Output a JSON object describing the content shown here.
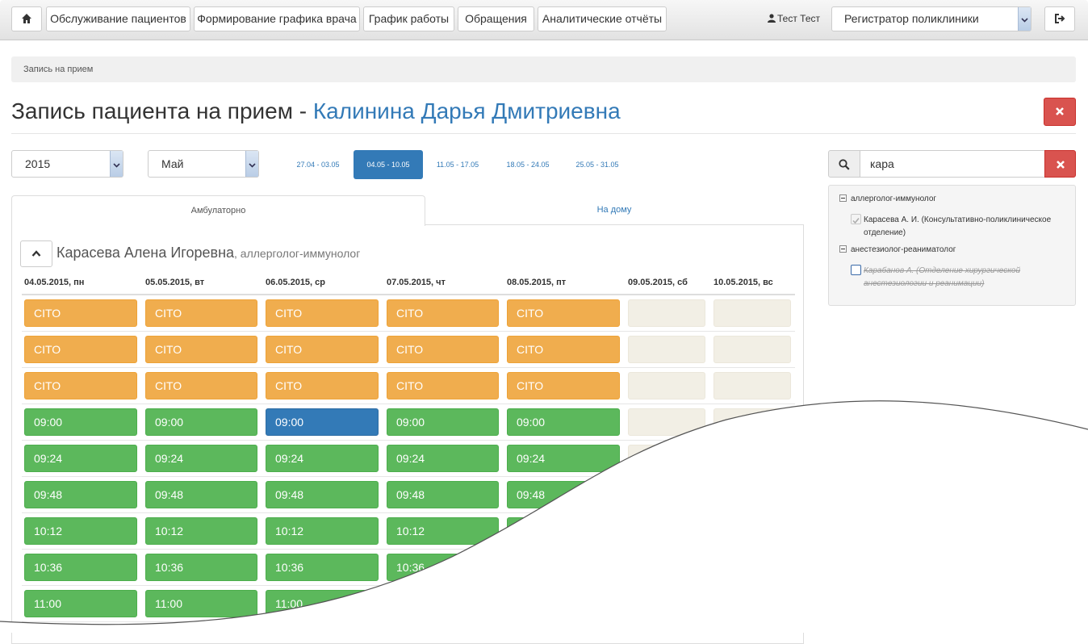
{
  "nav": {
    "items": [
      {
        "label": "Обслуживание пациентов"
      },
      {
        "label": "Формирование графика врача"
      },
      {
        "label": "График работы"
      },
      {
        "label": "Обращения"
      },
      {
        "label": "Аналитические отчёты"
      }
    ],
    "user_name": "Тест Тест",
    "role": "Регистратор поликлиники"
  },
  "breadcrumb": "Запись на прием",
  "page": {
    "title": "Запись пациента на прием -",
    "patient": "Калинина Дарья Дмитриевна"
  },
  "filters": {
    "year": "2015",
    "month": "Май",
    "weeks": [
      "27.04 - 03.05",
      "04.05 - 10.05",
      "11.05 - 17.05",
      "18.05 - 24.05",
      "25.05 - 31.05"
    ],
    "active_week": "04.05 - 10.05"
  },
  "tabs": [
    "Амбулаторно",
    "На дому"
  ],
  "doctor": {
    "name": "Карасева Алена Игоревна",
    "specialty": ", аллерголог-иммунолог"
  },
  "schedule": {
    "days": [
      "04.05.2015, пн",
      "05.05.2015, вт",
      "06.05.2015, ср",
      "07.05.2015, чт",
      "08.05.2015, пт",
      "09.05.2015, сб",
      "10.05.2015, вс"
    ],
    "cito_label": "CITO",
    "times": [
      "09:00",
      "09:24",
      "09:48",
      "10:12",
      "10:36",
      "11:00"
    ],
    "selected_slot": {
      "day": "06.05.2015, ср",
      "time": "09:00"
    }
  },
  "search": {
    "value": "кара"
  },
  "tree": {
    "groups": [
      {
        "label": "аллерголог-иммунолог",
        "item": "Карасева А. И. (Консультативно-поликлиническое отделение)",
        "checked": true
      },
      {
        "label": "анестезиолог-реаниматолог",
        "item": "Карабанов А. (Отделение хирургической анестезиологии и реанимации)",
        "checked": false
      }
    ]
  },
  "colors": {
    "cito": "#f0ad4e",
    "free": "#5cb85c",
    "selected": "#337ab7",
    "weekend": "#f2efe5",
    "danger": "#d9534f"
  }
}
